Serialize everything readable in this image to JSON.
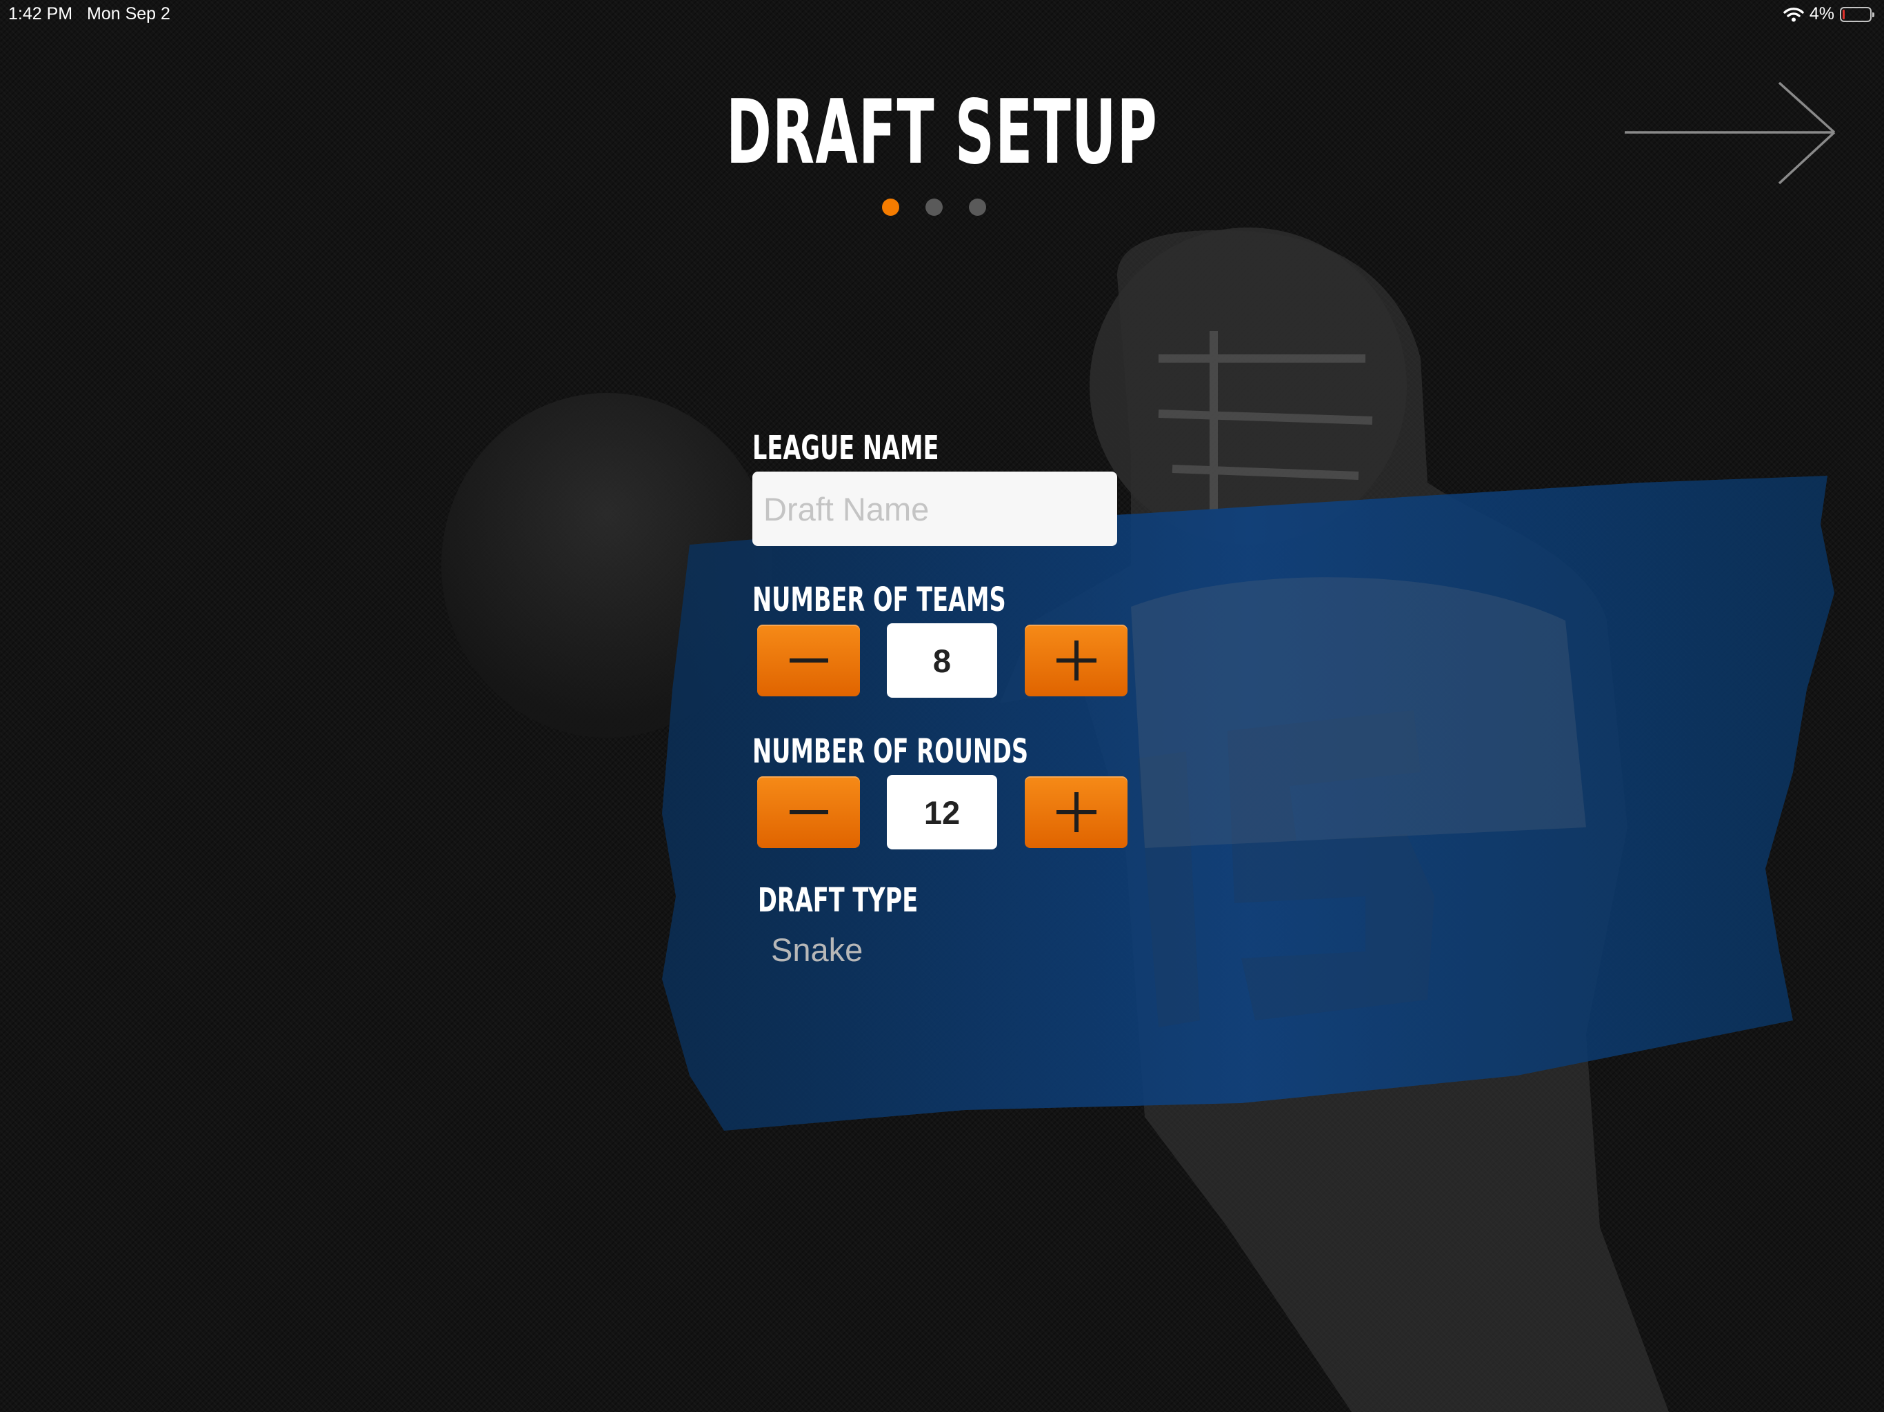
{
  "status_bar": {
    "time": "1:42 PM",
    "date": "Mon Sep 2",
    "battery_percent": "4%",
    "battery_level": 0.04
  },
  "page": {
    "title": "DRAFT SETUP",
    "step_count": 3,
    "active_step": 1
  },
  "form": {
    "league_name_label": "LEAGUE NAME",
    "league_name_placeholder": "Draft Name",
    "league_name_value": "",
    "teams_label": "NUMBER OF TEAMS",
    "teams_value": "8",
    "rounds_label": "NUMBER OF ROUNDS",
    "rounds_value": "12",
    "draft_type_label": "DRAFT TYPE",
    "draft_type_value": "Snake"
  },
  "icons": {
    "next": "arrow-right-icon",
    "decrement": "minus-icon",
    "increment": "plus-icon",
    "wifi": "wifi-icon",
    "battery": "battery-icon"
  },
  "colors": {
    "accent": "#f57c00",
    "background": "#131313",
    "brush": "#0d3a6b",
    "inactive_dot": "#5a5a5a"
  }
}
